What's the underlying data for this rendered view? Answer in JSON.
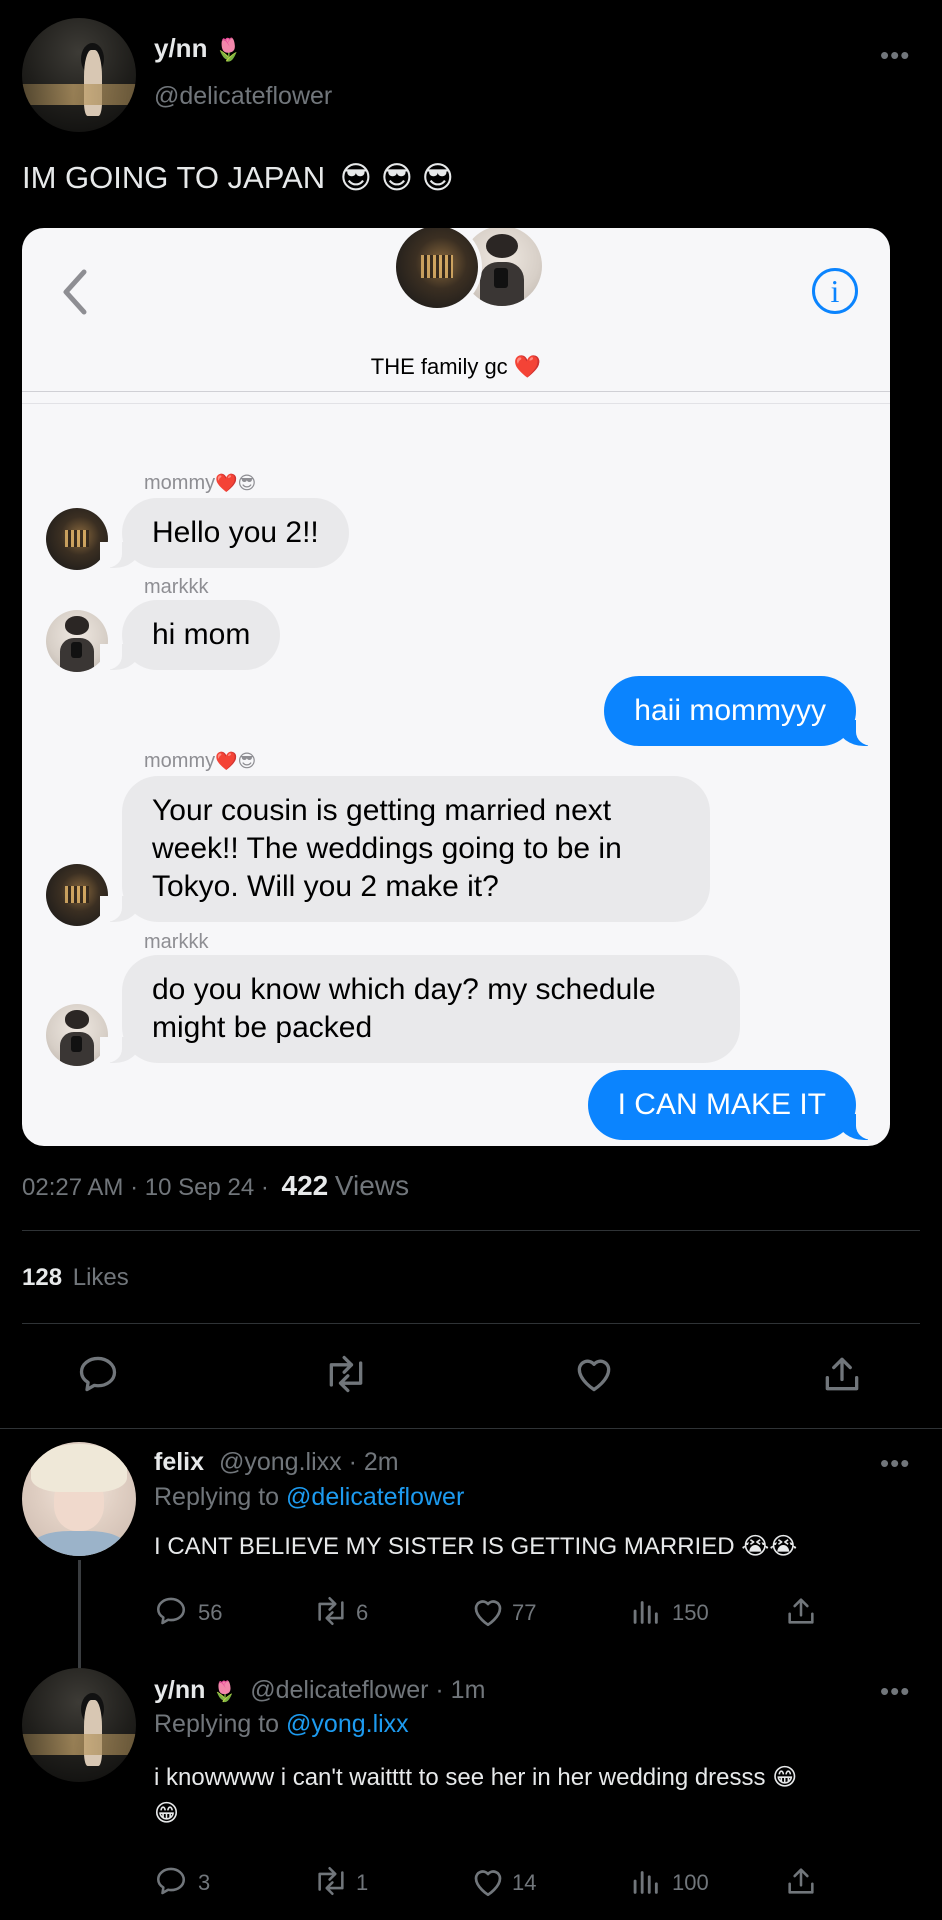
{
  "post": {
    "display_name": "y/nn",
    "name_emoji": "🌷",
    "handle": "@delicateflower",
    "text": "IM GOING TO JAPAN",
    "text_emojis": "😎 😎 😎",
    "more": "•••"
  },
  "chat": {
    "title": "THE family gc",
    "title_emoji": "❤️",
    "back": "‹",
    "info": "i",
    "messages": [
      {
        "sender": "mommy",
        "sender_emoji": "❤️😎",
        "text": "Hello you 2!!"
      },
      {
        "sender": "markkk",
        "text": "hi mom"
      },
      {
        "text": "haii mommyyy"
      },
      {
        "sender": "mommy",
        "sender_emoji": "❤️😎",
        "text": "Your cousin is getting married next week!! The weddings going to be in Tokyo. Will you 2 make it?"
      },
      {
        "sender": "markkk",
        "text": "do you know which day? my schedule might be packed"
      },
      {
        "text": "I CAN MAKE IT"
      }
    ]
  },
  "meta": {
    "time_date": "02:27 AM · 10 Sep 24 ·",
    "views_count": "422",
    "views_label": "Views",
    "likes_count": "128",
    "likes_label": "Likes"
  },
  "replies": [
    {
      "name": "felix",
      "handle_time": "@yong.lixx · 2m",
      "replying_label": "Replying to",
      "replying_to": "@delicateflower",
      "text": "I CANT BELIEVE MY SISTER IS GETTING MARRIED 😭😭",
      "comments": "56",
      "retweets": "6",
      "likes": "77",
      "views": "150",
      "more": "•••"
    },
    {
      "name": "y/nn",
      "name_emoji": "🌷",
      "handle_time": "@delicateflower · 1m",
      "replying_label": "Replying to",
      "replying_to": "@yong.lixx",
      "text": "i knowwww i can't waitttt to see her in her wedding dresss 😁",
      "text_line2": "😁",
      "comments": "3",
      "retweets": "1",
      "likes": "14",
      "views": "100",
      "more": "•••"
    }
  ],
  "colors": {
    "accent": "#1d9bf0",
    "imessage_blue": "#0b84fe",
    "heart_red": "#ff2d55"
  }
}
